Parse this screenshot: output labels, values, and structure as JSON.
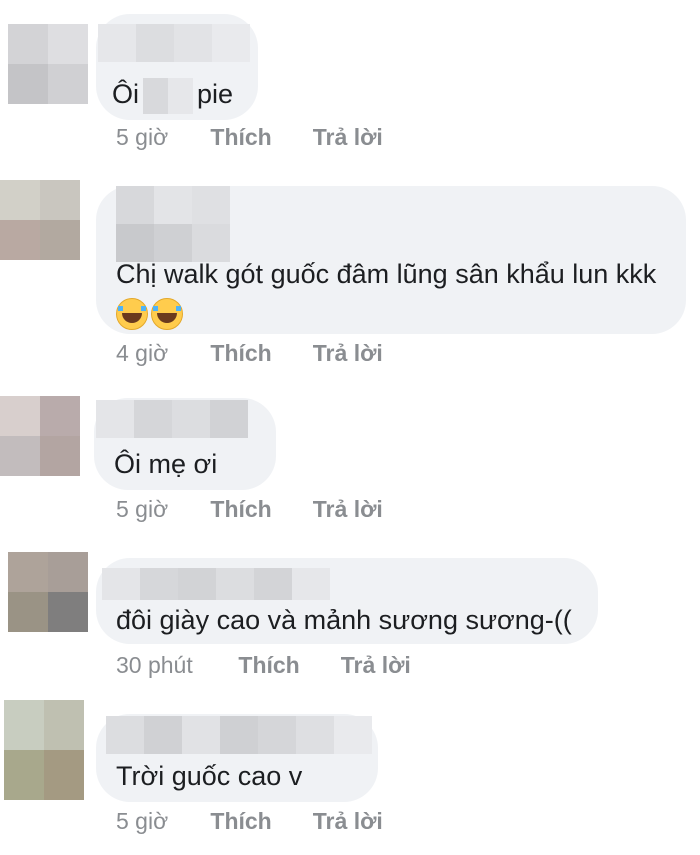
{
  "comments": [
    {
      "text_before": "Ôi",
      "text_after": "pie",
      "time": "5 giờ",
      "like": "Thích",
      "reply": "Trả lời"
    },
    {
      "line1": "Chị walk gót guốc đâm lũng sân khẩu lun kkk",
      "emoji": "face-with-tears-of-joy",
      "time": "4 giờ",
      "like": "Thích",
      "reply": "Trả lời"
    },
    {
      "text": "Ôi mẹ ơi",
      "time": "5 giờ",
      "like": "Thích",
      "reply": "Trả lời"
    },
    {
      "text": "đôi giày cao và mảnh sương sương-((",
      "time": "30 phút",
      "like": "Thích",
      "reply": "Trả lời"
    },
    {
      "text": "Trời guốc cao v",
      "time": "5 giờ",
      "like": "Thích",
      "reply": "Trả lời"
    }
  ],
  "colors": {
    "bubble": "#f0f2f5",
    "text": "#1c1e21",
    "meta": "#8a8d91"
  }
}
